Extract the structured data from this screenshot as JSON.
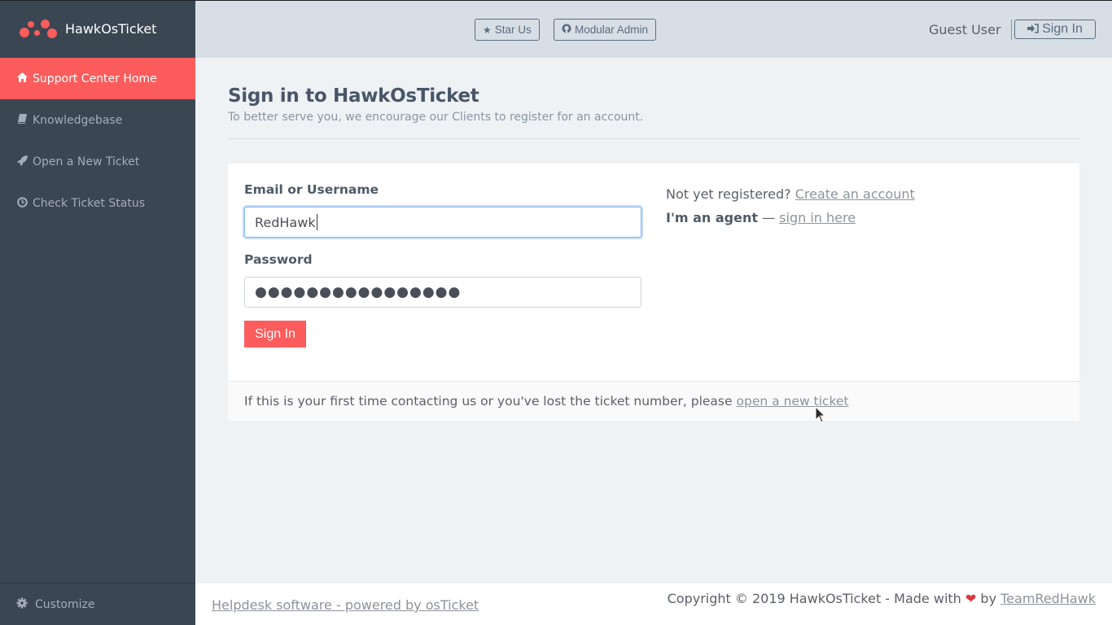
{
  "brand": {
    "name": "HawkOsTicket",
    "logo_icon": "dots-logo-icon",
    "accent": "#fc5c5c"
  },
  "sidebar": {
    "items": [
      {
        "label": "Support Center Home",
        "icon": "home-icon",
        "active": true
      },
      {
        "label": "Knowledgebase",
        "icon": "book-icon",
        "active": false
      },
      {
        "label": "Open a New Ticket",
        "icon": "rocket-icon",
        "active": false
      },
      {
        "label": "Check Ticket Status",
        "icon": "clock-icon",
        "active": false
      }
    ],
    "bottom": {
      "label": "Customize",
      "icon": "gear-icon"
    }
  },
  "header": {
    "star_label": "Star Us",
    "github_label": "Modular Admin",
    "user_label": "Guest User",
    "signin_label": "Sign In"
  },
  "page": {
    "title": "Sign in to HawkOsTicket",
    "subtitle": "To better serve you, we encourage our Clients to register for an account."
  },
  "form": {
    "username_label": "Email or Username",
    "username_value": "RedHawk",
    "password_label": "Password",
    "password_mask": "●●●●●●●●●●●●●●●●",
    "submit_label": "Sign In"
  },
  "register": {
    "prompt": "Not yet registered?",
    "create_link": "Create an account",
    "agent_text": "I'm an agent",
    "dash": " — ",
    "agent_link": "sign in here"
  },
  "notice": {
    "text": "If this is your first time contacting us or you've lost the ticket number, please",
    "link": "open a new ticket"
  },
  "footer": {
    "left_link": "Helpdesk software - powered by osTicket",
    "copyright": "Copyright © 2019 HawkOsTicket - Made with",
    "heart": "❤",
    "by": "by",
    "team_link": "TeamRedHawk"
  }
}
